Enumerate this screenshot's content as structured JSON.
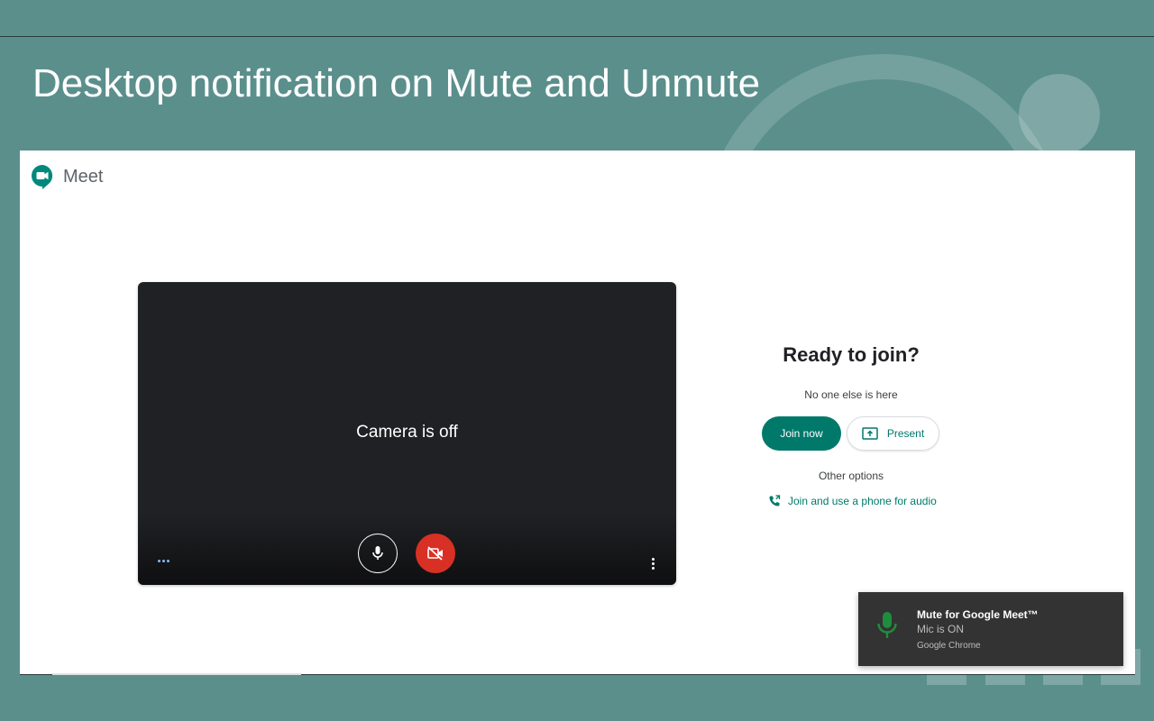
{
  "slide": {
    "title": "Desktop notification on Mute and Unmute"
  },
  "meet": {
    "app_name": "Meet",
    "preview": {
      "camera_status": "Camera is off",
      "controls": {
        "mic_icon": "microphone-icon",
        "camera_icon": "video-off-icon",
        "more_icon": "more-vertical-icon"
      }
    },
    "join_panel": {
      "title": "Ready to join?",
      "subtitle": "No one else is here",
      "join_now_label": "Join now",
      "present_label": "Present",
      "other_options_label": "Other options",
      "phone_audio_label": "Join and use a phone for audio"
    }
  },
  "notification": {
    "title": "Mute for Google Meet™",
    "body": "Mic is ON",
    "source": "Google Chrome",
    "icon": "microphone-icon"
  },
  "colors": {
    "slide_background": "#5a8f8c",
    "meet_teal": "#00796b",
    "camera_off_red": "#d93025",
    "mic_on_green": "#1e8e3e",
    "notification_background": "#333333"
  }
}
